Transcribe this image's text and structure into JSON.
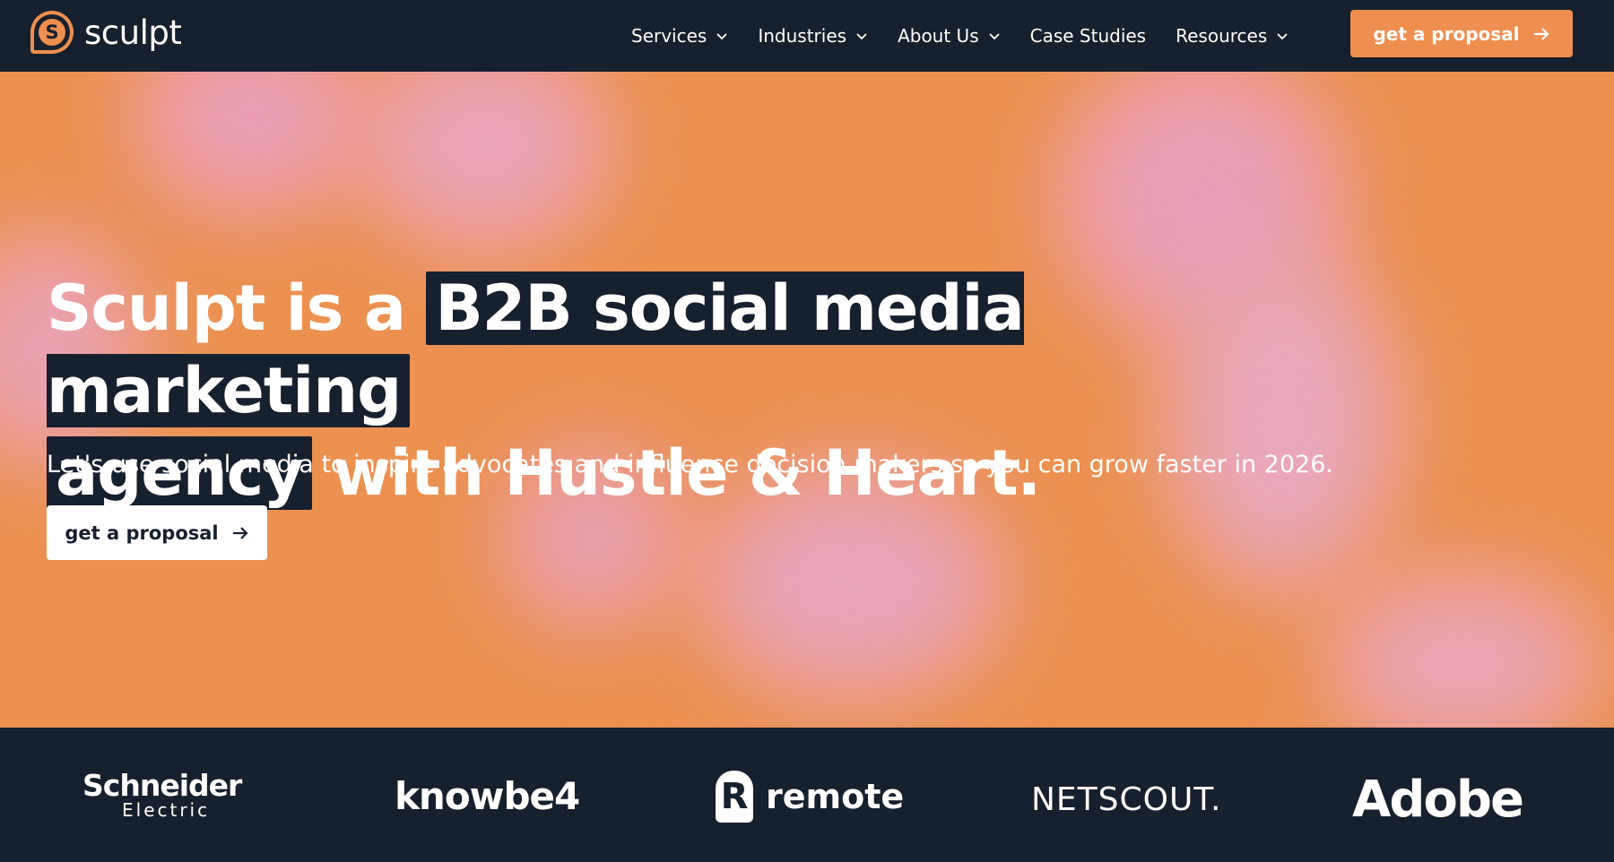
{
  "nav": {
    "logo_text": "sculpt",
    "logo_letter": "S",
    "items": [
      {
        "label": "Services",
        "has_dropdown": true
      },
      {
        "label": "Industries",
        "has_dropdown": true
      },
      {
        "label": "About Us",
        "has_dropdown": true
      },
      {
        "label": "Case Studies",
        "has_dropdown": false
      },
      {
        "label": "Resources",
        "has_dropdown": true
      }
    ],
    "cta_label": "get a proposal"
  },
  "hero": {
    "headline_part1": "Sculpt is a ",
    "headline_highlight1": "B2B social media marketing",
    "headline_highlight2": "agency",
    "headline_part2": " with Hustle & Heart.",
    "subline": "Let's use social media to inspire advocates and influence decision makers so you can grow faster in 2026.",
    "cta_label": "get a proposal"
  },
  "client_logos": {
    "schneider_main": "Schneider",
    "schneider_sub": "Electric",
    "knowbe4": "knowbe4",
    "remote": "remote",
    "remote_mark": "R",
    "netscout": "NETSCOUT.",
    "adobe": "Adobe"
  },
  "colors": {
    "navy": "#17202e",
    "accent_orange": "#ee8f4f",
    "hero_orange": "#ec9150",
    "hero_pink": "#eba0b6",
    "white": "#ffffff"
  },
  "icons": {
    "dropdown": "chevron-down-icon",
    "cta_arrow": "arrow-right-icon",
    "logo": "sculpt-logo-icon"
  }
}
